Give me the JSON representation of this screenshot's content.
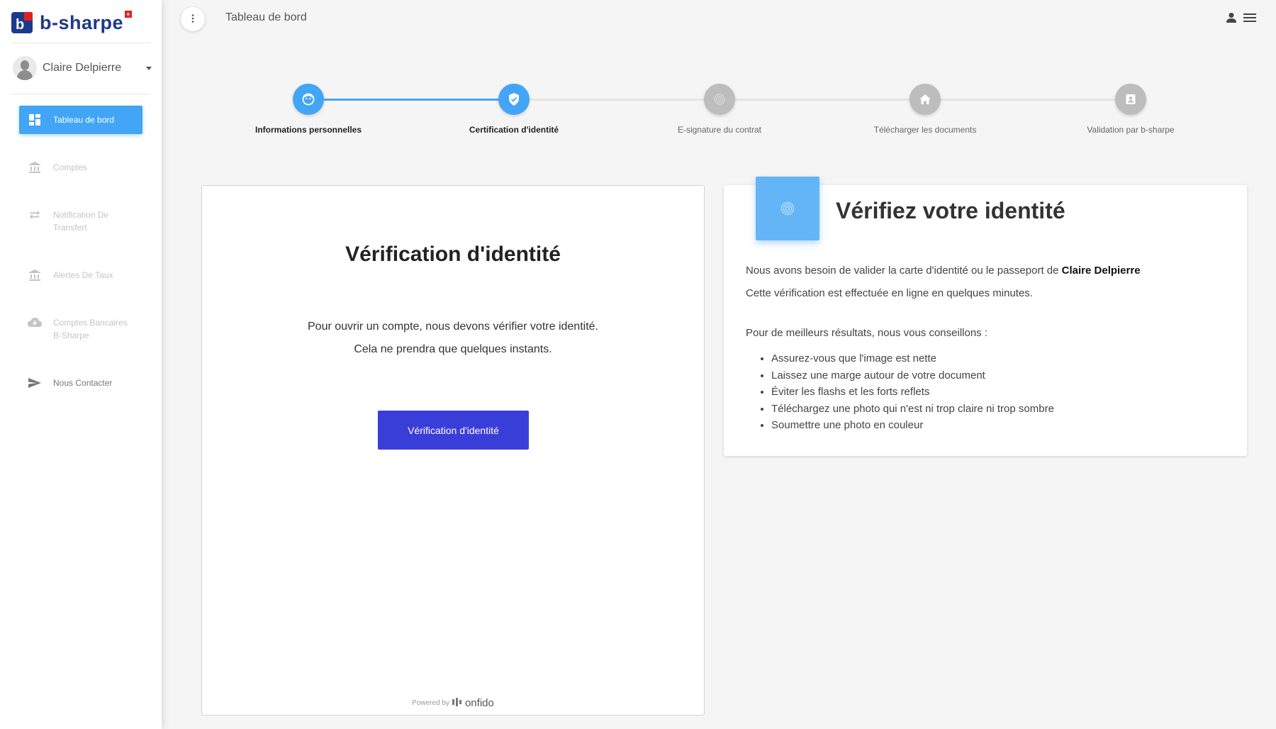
{
  "sidebar": {
    "logo": {
      "text": "b-sharpe",
      "flag": "+"
    },
    "user_name": "Claire Delpierre",
    "items": [
      {
        "label": "Tableau de bord",
        "icon": "dashboard-icon",
        "active": true
      },
      {
        "label": "Comptes",
        "icon": "bank-icon"
      },
      {
        "label": "Notification De Transfert",
        "icon": "transfer-icon"
      },
      {
        "label": "Alertes De Taux",
        "icon": "bank-icon"
      },
      {
        "label": "Comptes Bancaires B-Sharpe",
        "icon": "cloud-download-icon"
      },
      {
        "label": "Nous Contacter",
        "icon": "send-icon"
      }
    ]
  },
  "topbar": {
    "title": "Tableau de bord"
  },
  "stepper": {
    "steps": [
      {
        "label": "Informations personnelles",
        "icon": "face-icon",
        "state": "done"
      },
      {
        "label": "Certification d'identité",
        "icon": "shield-check-icon",
        "state": "active"
      },
      {
        "label": "E-signature du contrat",
        "icon": "fingerprint-icon",
        "state": "pending"
      },
      {
        "label": "Télécharger les documents",
        "icon": "home-icon",
        "state": "pending"
      },
      {
        "label": "Validation par b-sharpe",
        "icon": "badge-icon",
        "state": "pending"
      }
    ]
  },
  "verification": {
    "title": "Vérification d'identité",
    "line1": "Pour ouvrir un compte, nous devons vérifier votre identité.",
    "line2": "Cela ne prendra que quelques instants.",
    "button": "Vérification d'identité",
    "powered_by": "Powered by",
    "powered_brand": "onfido"
  },
  "info": {
    "title": "Vérifiez votre identité",
    "intro_prefix": "Nous avons besoin de valider la carte d'identité ou le passeport de",
    "intro_name": "Claire Delpierre",
    "line2": "Cette vérification est effectuée en ligne en quelques minutes.",
    "tips_intro": "Pour de meilleurs résultats, nous vous conseillons :",
    "tips": [
      "Assurez-vous que l'image est nette",
      "Laissez une marge autour de votre document",
      "Éviter les flashs et les forts reflets",
      "Téléchargez une photo qui n'est ni trop claire ni trop sombre",
      "Soumettre une photo en couleur"
    ]
  },
  "colors": {
    "accent": "#42a5f5",
    "button": "#3a3ed8",
    "logo": "#1d3a8a",
    "inactive_step": "#bdbdbd"
  }
}
